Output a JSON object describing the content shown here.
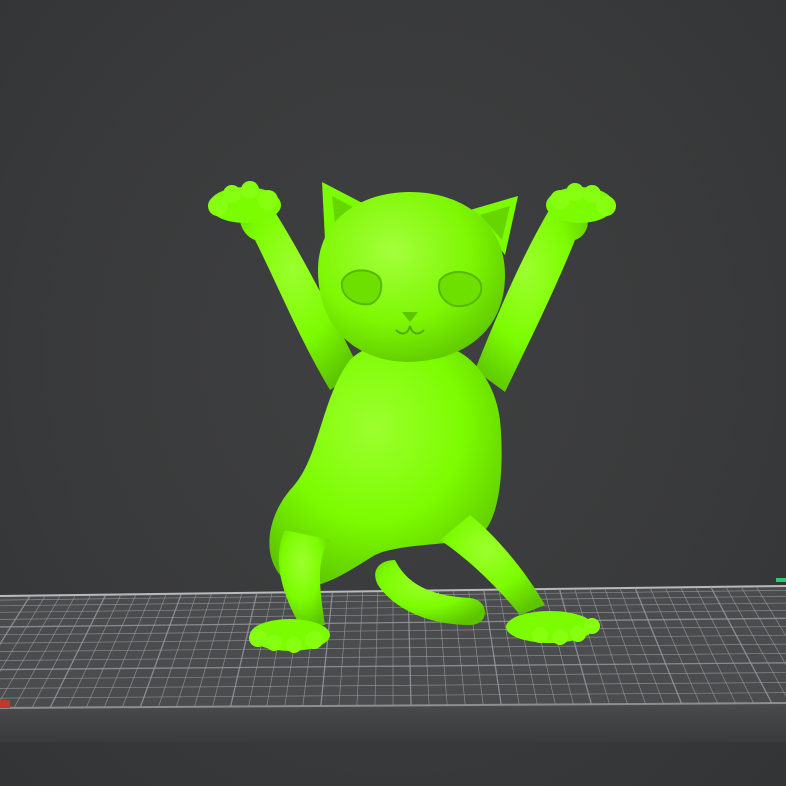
{
  "viewport": {
    "background": "#3a3b3c"
  },
  "model": {
    "subject": "dancing-cat-figurine",
    "color": "#7cfc00",
    "shadow_color": "#4ea800",
    "highlight_color": "#a6ff3a"
  },
  "build_plate": {
    "surface_color": "#4d4e50",
    "grid_color": "#9a9b9e",
    "edge_color": "#5a5b5d",
    "front_color": "#454648",
    "marker_red": "#c0392b",
    "marker_green": "#2ecc71"
  }
}
